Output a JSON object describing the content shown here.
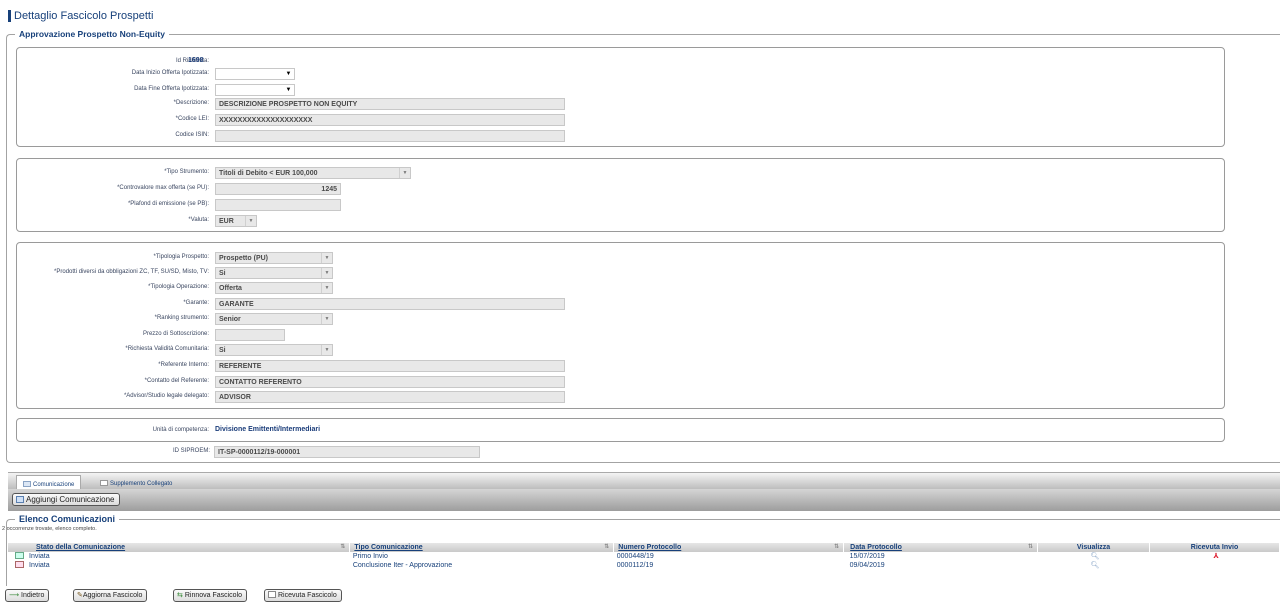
{
  "page_title": "Dettaglio Fascicolo Prospetti",
  "section_title": "Approvazione Prospetto Non-Equity",
  "box1": {
    "id_richiesta_label": "Id Richiesta:",
    "id_richiesta_value": "1698",
    "data_inizio_label": "Data Inizio Offerta Ipotizzata:",
    "data_inizio_value": "",
    "data_fine_label": "Data Fine Offerta Ipotizzata:",
    "data_fine_value": "",
    "descrizione_label": "*Descrizione:",
    "descrizione_value": "DESCRIZIONE PROSPETTO NON EQUITY",
    "lei_label": "*Codice LEI:",
    "lei_value": "XXXXXXXXXXXXXXXXXXXX",
    "isin_label": "Codice ISIN:",
    "isin_value": ""
  },
  "box2": {
    "tipo_label": "*Tipo Strumento:",
    "tipo_value": "Titoli di Debito < EUR 100,000",
    "controvalore_label": "*Controvalore max offerta (se PU):",
    "controvalore_value": "1245",
    "plafond_label": "*Plafond di emissione (se PB):",
    "plafond_value": "",
    "valuta_label": "*Valuta:",
    "valuta_value": "EUR"
  },
  "box3": {
    "tipologia_label": "*Tipologia Prospetto:",
    "tipologia_value": "Prospetto (PU)",
    "prodotti_label": "*Prodotti diversi da obbligazioni ZC, TF, SU/SD, Misto, TV:",
    "prodotti_value": "Si",
    "operazione_label": "*Tipologia Operazione:",
    "operazione_value": "Offerta",
    "garante_label": "*Garante:",
    "garante_value": "GARANTE",
    "ranking_label": "*Ranking strumento:",
    "ranking_value": "Senior",
    "prezzo_label": "Prezzo di Sottoscrizione:",
    "prezzo_value": "",
    "validita_label": "*Richiesta Validità Comunitaria:",
    "validita_value": "Si",
    "referente_label": "*Referente Interno:",
    "referente_value": "REFERENTE",
    "contatto_label": "*Contatto del Referente:",
    "contatto_value": "CONTATTO REFERENTO",
    "advisor_label": "*Advisor/Studio legale delegato:",
    "advisor_value": "ADVISOR"
  },
  "box4": {
    "unita_label": "Unità di competenza:",
    "unita_value": "Divisione Emittenti/Intermediari"
  },
  "siproem": {
    "label": "ID SIPROEM:",
    "value": "IT-SP-0000112/19-000001"
  },
  "tabs": {
    "comunicazione": "Comunicazione",
    "supplemento": "Supplemento Collegato"
  },
  "toolbar": {
    "aggiungi": "Aggiungi Comunicazione"
  },
  "list": {
    "title": "Elenco Comunicazioni",
    "occurrences": "2 occorrenze trovate, elenco completo.",
    "headers": [
      "Stato della Comunicazione",
      "Tipo Comunicazione",
      "Numero Protocollo",
      "Data Protocollo",
      "Visualizza",
      "Ricevuta Invio"
    ],
    "rows": [
      {
        "stato": "Inviata",
        "tipo": "Primo Invio",
        "numero": "0000448/19",
        "data": "15/07/2019"
      },
      {
        "stato": "Inviata",
        "tipo": "Conclusione Iter - Approvazione",
        "numero": "0000112/19",
        "data": "09/04/2019"
      }
    ]
  },
  "bottom": {
    "indietro": "Indietro",
    "aggiorna": "Aggiorna Fascicolo",
    "rinnova": "Rinnova Fascicolo",
    "ricevuta": "Ricevuta Fascicolo"
  }
}
